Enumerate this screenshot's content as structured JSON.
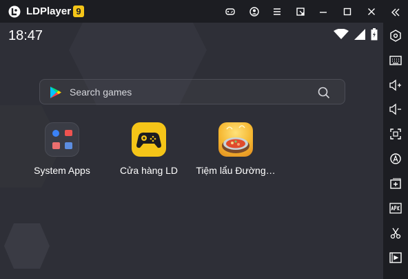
{
  "titlebar": {
    "title": "LDPlayer",
    "version": "9",
    "buttons": [
      "gamepad-icon",
      "account-icon",
      "menu-icon",
      "export-icon",
      "minimize-icon",
      "maximize-icon",
      "close-icon"
    ]
  },
  "status": {
    "time": "18:47"
  },
  "search": {
    "placeholder": "Search games"
  },
  "apps": [
    {
      "label": "System Apps"
    },
    {
      "label": "Cửa hàng LD"
    },
    {
      "label": "Tiệm lẩu Đường…"
    }
  ],
  "sidebar": {
    "items": [
      "collapse-icon",
      "settings-icon",
      "keyboard-icon",
      "volume-up-icon",
      "volume-down-icon",
      "fullscreen-icon",
      "rotate-icon",
      "add-instance-icon",
      "apk-icon",
      "scissors-icon",
      "video-icon"
    ]
  },
  "colors": {
    "accent": "#f5c518",
    "background": "#2e2f37",
    "chrome": "#1c1d22"
  }
}
